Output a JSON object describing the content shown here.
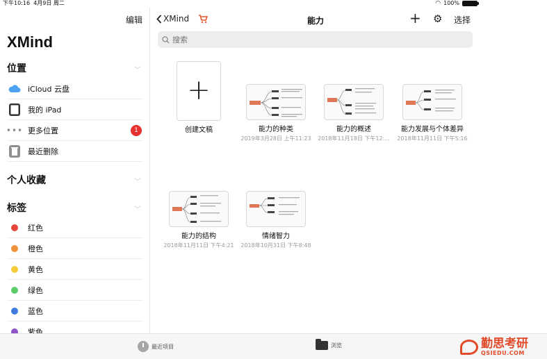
{
  "status": {
    "time": "下午10:16",
    "date": "4月9日 周二",
    "battery": "100%"
  },
  "sidebar": {
    "edit_label": "编辑",
    "app_title": "XMind",
    "locations_title": "位置",
    "locations": [
      {
        "label": "iCloud 云盘",
        "icon": "icloud-icon"
      },
      {
        "label": "我的 iPad",
        "icon": "ipad-icon"
      },
      {
        "label": "更多位置",
        "icon": "more-icon",
        "badge": "1"
      },
      {
        "label": "最近删除",
        "icon": "trash-icon"
      }
    ],
    "favorites_title": "个人收藏",
    "tags_title": "标签",
    "tags": [
      {
        "label": "红色",
        "color": "#e5483a"
      },
      {
        "label": "橙色",
        "color": "#f0933a"
      },
      {
        "label": "黄色",
        "color": "#f4cb3b"
      },
      {
        "label": "绿色",
        "color": "#5ecb6b"
      },
      {
        "label": "蓝色",
        "color": "#3f7ee0"
      },
      {
        "label": "紫色",
        "color": "#8e55c9"
      }
    ]
  },
  "nav": {
    "back_label": "XMind",
    "title": "能力",
    "select_label": "选择"
  },
  "search": {
    "placeholder": "搜索"
  },
  "files": {
    "create_label": "创建文稿",
    "items": [
      {
        "name": "能力的种类",
        "date": "2019年3月28日 上午11:23"
      },
      {
        "name": "能力的概述",
        "date": "2018年11月18日 下午12:..."
      },
      {
        "name": "能力发展与个体差异",
        "date": "2018年11月11日 下午5:16"
      },
      {
        "name": "能力的结构",
        "date": "2018年11月11日 下午4:21"
      },
      {
        "name": "情绪智力",
        "date": "2018年10月31日 下午8:48"
      }
    ]
  },
  "tabbar": {
    "recent_label": "最近项目",
    "browse_label": "浏览"
  },
  "watermark": {
    "cn": "勤思考研",
    "en": "QSIEDU.COM"
  },
  "colors": {
    "accent": "#e5322c",
    "watermark": "#e24a2a"
  }
}
